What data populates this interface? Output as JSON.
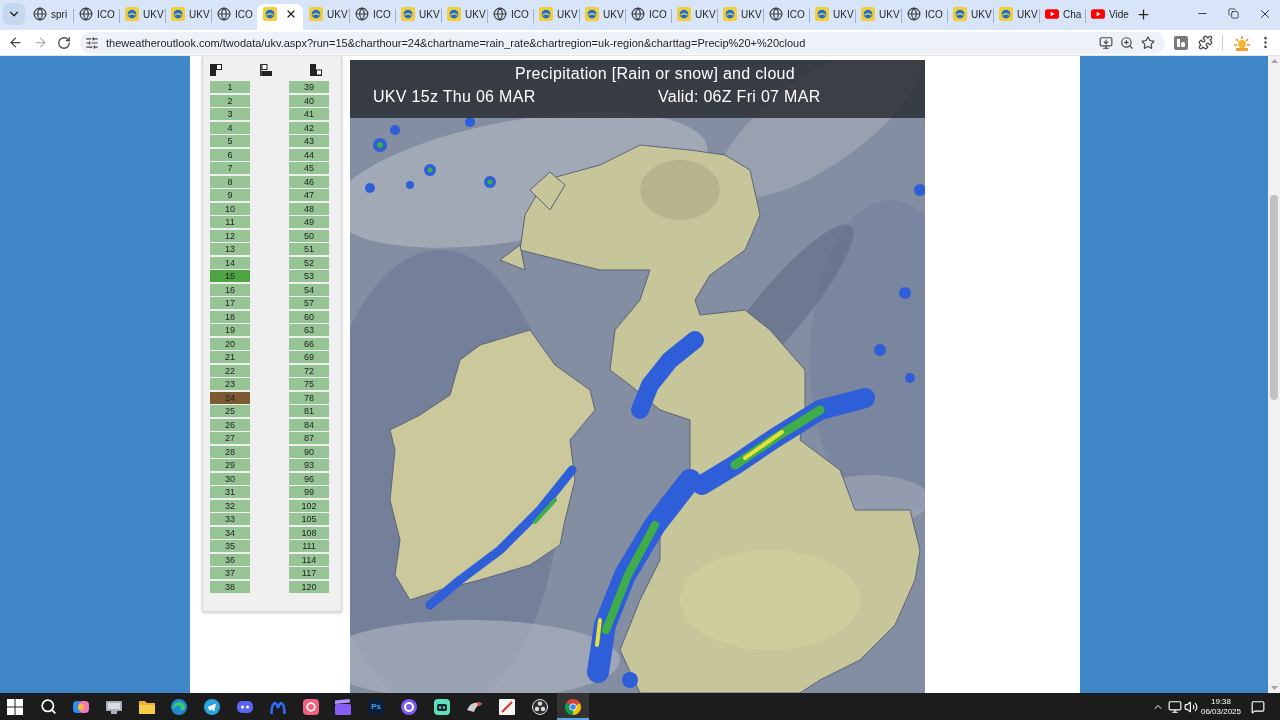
{
  "browser": {
    "tabs": [
      {
        "label": "spri",
        "kind": "globe",
        "selected": false
      },
      {
        "label": "ICO",
        "kind": "globe",
        "selected": false
      },
      {
        "label": "UKV",
        "kind": "site",
        "selected": false
      },
      {
        "label": "UKV",
        "kind": "site",
        "selected": false
      },
      {
        "label": "ICO",
        "kind": "globe",
        "selected": false
      },
      {
        "kind": "site",
        "selected": true
      },
      {
        "label": "UKV",
        "kind": "site",
        "selected": false
      },
      {
        "label": "ICO",
        "kind": "globe",
        "selected": false
      },
      {
        "label": "UKV",
        "kind": "site",
        "selected": false
      },
      {
        "label": "UKV",
        "kind": "site",
        "selected": false
      },
      {
        "label": "ICO",
        "kind": "globe",
        "selected": false
      },
      {
        "label": "UKV",
        "kind": "site",
        "selected": false
      },
      {
        "label": "UKV",
        "kind": "site",
        "selected": false
      },
      {
        "label": "ICO",
        "kind": "globe",
        "selected": false
      },
      {
        "label": "UKV",
        "kind": "site",
        "selected": false
      },
      {
        "label": "UKV",
        "kind": "site",
        "selected": false
      },
      {
        "label": "ICO",
        "kind": "globe",
        "selected": false
      },
      {
        "label": "UKV",
        "kind": "site",
        "selected": false
      },
      {
        "label": "UKV",
        "kind": "site",
        "selected": false
      },
      {
        "label": "ICO",
        "kind": "globe",
        "selected": false
      },
      {
        "label": "UKV",
        "kind": "site",
        "selected": false
      },
      {
        "label": "UKV",
        "kind": "site",
        "selected": false
      },
      {
        "label": "Cha",
        "kind": "video",
        "selected": false
      },
      {
        "label": "Vide",
        "kind": "video",
        "selected": false
      }
    ],
    "navigation": {
      "back_disabled": false,
      "forward_disabled": true
    },
    "address_bar": {
      "url": "theweatheroutlook.com/twodata/ukv.aspx?run=15&charthour=24&chartname=rain_rate&chartregion=uk-region&charttag=Precip%20+%20cloud"
    }
  },
  "hours_panel": {
    "columns": [
      {
        "items": [
          {
            "label": "1",
            "selected": false,
            "hovered": false
          },
          {
            "label": "2",
            "selected": false,
            "hovered": false
          },
          {
            "label": "3",
            "selected": false,
            "hovered": false
          },
          {
            "label": "4",
            "selected": false,
            "hovered": false
          },
          {
            "label": "5",
            "selected": false,
            "hovered": false
          },
          {
            "label": "6",
            "selected": false,
            "hovered": false
          },
          {
            "label": "7",
            "selected": false,
            "hovered": false
          },
          {
            "label": "8",
            "selected": false,
            "hovered": false
          },
          {
            "label": "9",
            "selected": false,
            "hovered": false
          },
          {
            "label": "10",
            "selected": false,
            "hovered": false
          },
          {
            "label": "11",
            "selected": false,
            "hovered": false
          },
          {
            "label": "12",
            "selected": false,
            "hovered": false
          },
          {
            "label": "13",
            "selected": false,
            "hovered": false
          },
          {
            "label": "14",
            "selected": false,
            "hovered": false
          },
          {
            "label": "15",
            "selected": true,
            "hovered": false
          },
          {
            "label": "16",
            "selected": false,
            "hovered": false
          },
          {
            "label": "17",
            "selected": false,
            "hovered": false
          },
          {
            "label": "18",
            "selected": false,
            "hovered": false
          },
          {
            "label": "19",
            "selected": false,
            "hovered": false
          },
          {
            "label": "20",
            "selected": false,
            "hovered": false
          },
          {
            "label": "21",
            "selected": false,
            "hovered": false
          },
          {
            "label": "22",
            "selected": false,
            "hovered": false
          },
          {
            "label": "23",
            "selected": false,
            "hovered": false
          },
          {
            "label": "24",
            "selected": false,
            "hovered": true
          },
          {
            "label": "25",
            "selected": false,
            "hovered": false
          },
          {
            "label": "26",
            "selected": false,
            "hovered": false
          },
          {
            "label": "27",
            "selected": false,
            "hovered": false
          },
          {
            "label": "28",
            "selected": false,
            "hovered": false
          },
          {
            "label": "29",
            "selected": false,
            "hovered": false
          },
          {
            "label": "30",
            "selected": false,
            "hovered": false
          },
          {
            "label": "31",
            "selected": false,
            "hovered": false
          },
          {
            "label": "32",
            "selected": false,
            "hovered": false
          },
          {
            "label": "33",
            "selected": false,
            "hovered": false
          },
          {
            "label": "34",
            "selected": false,
            "hovered": false
          },
          {
            "label": "35",
            "selected": false,
            "hovered": false
          },
          {
            "label": "36",
            "selected": false,
            "hovered": false
          },
          {
            "label": "37",
            "selected": false,
            "hovered": false
          },
          {
            "label": "38",
            "selected": false,
            "hovered": false
          }
        ]
      },
      {
        "items": [
          {
            "label": "39",
            "selected": false,
            "hovered": false
          },
          {
            "label": "40",
            "selected": false,
            "hovered": false
          },
          {
            "label": "41",
            "selected": false,
            "hovered": false
          },
          {
            "label": "42",
            "selected": false,
            "hovered": false
          },
          {
            "label": "43",
            "selected": false,
            "hovered": false
          },
          {
            "label": "44",
            "selected": false,
            "hovered": false
          },
          {
            "label": "45",
            "selected": false,
            "hovered": false
          },
          {
            "label": "46",
            "selected": false,
            "hovered": false
          },
          {
            "label": "47",
            "selected": false,
            "hovered": false
          },
          {
            "label": "48",
            "selected": false,
            "hovered": false
          },
          {
            "label": "49",
            "selected": false,
            "hovered": false
          },
          {
            "label": "50",
            "selected": false,
            "hovered": false
          },
          {
            "label": "51",
            "selected": false,
            "hovered": false
          },
          {
            "label": "52",
            "selected": false,
            "hovered": false
          },
          {
            "label": "53",
            "selected": false,
            "hovered": false
          },
          {
            "label": "54",
            "selected": false,
            "hovered": false
          },
          {
            "label": "57",
            "selected": false,
            "hovered": false
          },
          {
            "label": "60",
            "selected": false,
            "hovered": false
          },
          {
            "label": "63",
            "selected": false,
            "hovered": false
          },
          {
            "label": "66",
            "selected": false,
            "hovered": false
          },
          {
            "label": "69",
            "selected": false,
            "hovered": false
          },
          {
            "label": "72",
            "selected": false,
            "hovered": false
          },
          {
            "label": "75",
            "selected": false,
            "hovered": false
          },
          {
            "label": "78",
            "selected": false,
            "hovered": false
          },
          {
            "label": "81",
            "selected": false,
            "hovered": false
          },
          {
            "label": "84",
            "selected": false,
            "hovered": false
          },
          {
            "label": "87",
            "selected": false,
            "hovered": false
          },
          {
            "label": "90",
            "selected": false,
            "hovered": false
          },
          {
            "label": "93",
            "selected": false,
            "hovered": false
          },
          {
            "label": "96",
            "selected": false,
            "hovered": false
          },
          {
            "label": "99",
            "selected": false,
            "hovered": false
          },
          {
            "label": "102",
            "selected": false,
            "hovered": false
          },
          {
            "label": "105",
            "selected": false,
            "hovered": false
          },
          {
            "label": "108",
            "selected": false,
            "hovered": false
          },
          {
            "label": "111",
            "selected": false,
            "hovered": false
          },
          {
            "label": "114",
            "selected": false,
            "hovered": false
          },
          {
            "label": "117",
            "selected": false,
            "hovered": false
          },
          {
            "label": "120",
            "selected": false,
            "hovered": false
          }
        ]
      }
    ]
  },
  "chart": {
    "title": "Precipitation [Rain or snow] and cloud",
    "run": "UKV 15z Thu 06 MAR",
    "valid": "Valid: 06Z Fri 07 MAR"
  },
  "taskbar": {
    "apps": [
      {
        "kind": "start",
        "selected": false
      },
      {
        "kind": "search",
        "selected": false
      },
      {
        "kind": "swirl",
        "selected": false
      },
      {
        "kind": "computer",
        "selected": false
      },
      {
        "kind": "folder",
        "selected": false
      },
      {
        "kind": "wave",
        "selected": false
      },
      {
        "kind": "plane",
        "selected": false
      },
      {
        "kind": "gamepad",
        "selected": false
      },
      {
        "kind": "claw",
        "selected": false
      },
      {
        "kind": "camera",
        "selected": false
      },
      {
        "kind": "clapper",
        "selected": false
      },
      {
        "kind": "tile",
        "label": "Ps",
        "selected": false
      },
      {
        "kind": "ring",
        "selected": false
      },
      {
        "kind": "robot",
        "selected": false
      },
      {
        "kind": "bird",
        "selected": false
      },
      {
        "kind": "slash",
        "selected": false
      },
      {
        "kind": "aperture",
        "selected": false
      },
      {
        "kind": "browser",
        "selected": true
      }
    ],
    "clock": {
      "time": "19:38",
      "date": "06/03/2025"
    }
  }
}
